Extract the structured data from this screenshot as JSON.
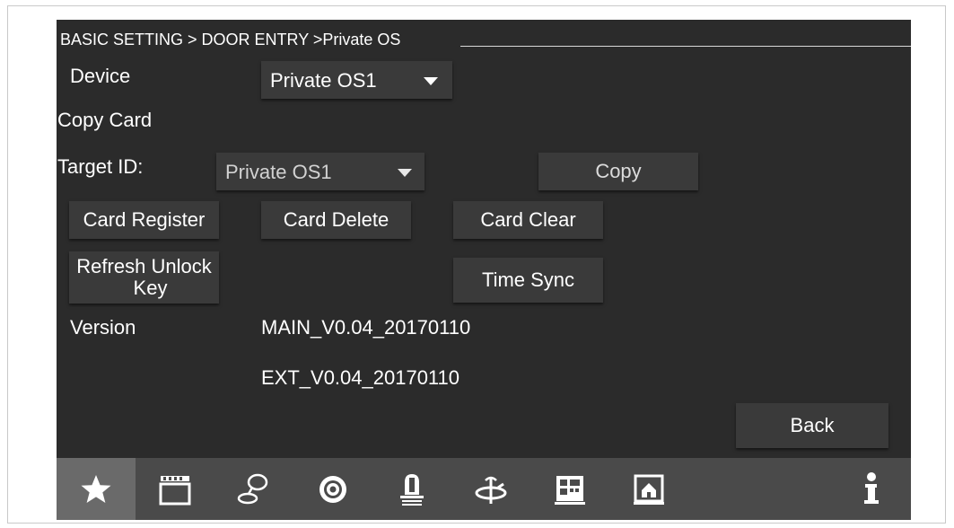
{
  "breadcrumb": "BASIC SETTING > DOOR ENTRY >Private OS",
  "device": {
    "label": "Device",
    "selected": "Private OS1"
  },
  "copy_card": {
    "label": "Copy Card"
  },
  "target": {
    "label": "Target ID:",
    "selected": "Private OS1",
    "copy_label": "Copy"
  },
  "buttons": {
    "card_register": "Card Register",
    "card_delete": "Card Delete",
    "card_clear": "Card Clear",
    "refresh_unlock_key_line1": "Refresh Unlock",
    "refresh_unlock_key_line2": "Key",
    "time_sync": "Time Sync",
    "back": "Back"
  },
  "version": {
    "label": "Version",
    "main": "MAIN_V0.04_20170110",
    "ext": "EXT_V0.04_20170110"
  },
  "nav": {
    "active": "favorites",
    "items": [
      "star-icon",
      "clapperboard-icon",
      "chat-bubble-icon",
      "camera-lens-icon",
      "bell-icon",
      "satellite-dish-icon",
      "building-icon",
      "home-icon",
      "info-icon"
    ]
  },
  "colors": {
    "background": "#2b2b2b",
    "button": "#3a3a3a",
    "navbar": "#4a4a4a",
    "nav_active": "#6a6a6a",
    "text": "#ffffff"
  }
}
